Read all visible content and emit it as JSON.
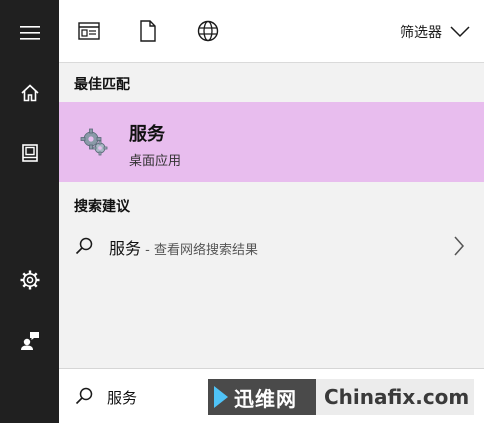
{
  "filter": {
    "label": "筛选器"
  },
  "sections": {
    "best_match": "最佳匹配",
    "search_suggestions": "搜索建议"
  },
  "best_match_item": {
    "title": "服务",
    "subtitle": "桌面应用"
  },
  "suggestion": {
    "query": "服务",
    "description": " - 查看网络搜索结果"
  },
  "search": {
    "value": "服务"
  },
  "watermark": {
    "cn": "迅维网",
    "en": "Chinafix.com"
  },
  "colors": {
    "sidebar_bg": "#202020",
    "selected_bg": "#e8bdee",
    "panel_bg": "#f2f2f2"
  },
  "icons": {
    "sidebar": [
      "hamburger-icon",
      "home-icon",
      "documents-icon",
      "settings-icon",
      "user-icon"
    ],
    "toolbar": [
      "apps-icon",
      "document-icon",
      "web-icon"
    ],
    "filter": "chevron-down-icon",
    "suggestion": [
      "search-icon",
      "chevron-right-icon"
    ],
    "search_box": "search-icon"
  }
}
